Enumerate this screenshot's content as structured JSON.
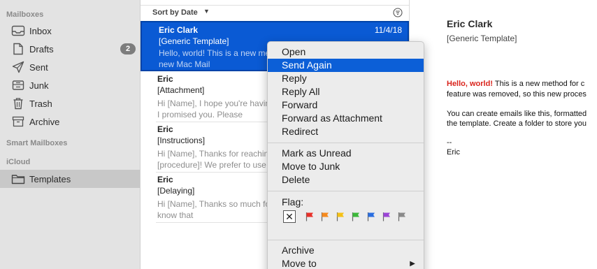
{
  "sidebar": {
    "mailboxes_header": "Mailboxes",
    "items": [
      {
        "label": "Inbox",
        "icon": "inbox-icon"
      },
      {
        "label": "Drafts",
        "icon": "drafts-icon",
        "badge": "2"
      },
      {
        "label": "Sent",
        "icon": "sent-icon"
      },
      {
        "label": "Junk",
        "icon": "junk-icon"
      },
      {
        "label": "Trash",
        "icon": "trash-icon"
      },
      {
        "label": "Archive",
        "icon": "archive-icon"
      }
    ],
    "smart_header": "Smart Mailboxes",
    "icloud_header": "iCloud",
    "icloud_items": [
      {
        "label": "Templates",
        "icon": "folder-icon",
        "selected": true
      }
    ]
  },
  "list": {
    "sort_label": "Sort by Date",
    "messages": [
      {
        "from": "Eric Clark",
        "date": "11/4/18",
        "subject": "[Generic Template]",
        "preview": "Hello, world! This is a new method for creating templates in the new Mac Mail",
        "selected": true
      },
      {
        "from": "Eric",
        "date": "",
        "subject": "[Attachment]",
        "preview": "Hi [Name], I hope you're having a great day! Here's the document I promised you. Please",
        "selected": false
      },
      {
        "from": "Eric",
        "date": "",
        "subject": "[Instructions]",
        "preview": "Hi [Name], Thanks for reaching out! Please follow these [procedure]! We prefer to use",
        "selected": false
      },
      {
        "from": "Eric",
        "date": "",
        "subject": "[Delaying]",
        "preview": "Hi [Name], Thanks so much for your email! I just wanted to let you know that",
        "selected": false
      }
    ]
  },
  "reader": {
    "from": "Eric Clark",
    "subject": "[Generic Template]",
    "body_highlight": "Hello, world!",
    "body_line1_rest": " This is a new method for c",
    "body_line2": "feature was removed, so this new proces",
    "body_line3": "You can create emails like this, formatted",
    "body_line4": "the template. Create a folder to store you",
    "sig_dash": "--",
    "sig_name": "Eric"
  },
  "context_menu": {
    "items_group1": [
      "Open",
      "Send Again",
      "Reply",
      "Reply All",
      "Forward",
      "Forward as Attachment",
      "Redirect"
    ],
    "highlighted": "Send Again",
    "items_group2": [
      "Mark as Unread",
      "Move to Junk",
      "Delete"
    ],
    "flag_label": "Flag:",
    "flag_colors": [
      "#e8312a",
      "#f58a1f",
      "#f5c116",
      "#3cb83a",
      "#2a6ee0",
      "#9b45d6",
      "#8a8a8a"
    ],
    "items_group4": [
      "Archive",
      "Move to"
    ]
  }
}
